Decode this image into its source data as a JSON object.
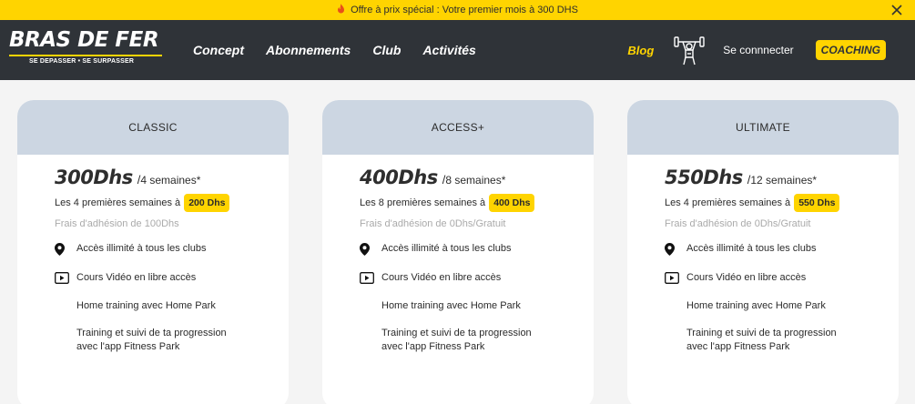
{
  "promo": {
    "text": "Offre à prix spécial : Votre premier mois à 300 DHS",
    "fire_icon": "fire-icon",
    "close_icon": "close-icon"
  },
  "brand": {
    "name": "BRAS DE FER",
    "tagline": "SE DEPASSER • SE SURPASSER"
  },
  "nav": {
    "links": [
      "Concept",
      "Abonnements",
      "Club",
      "Activités"
    ],
    "blog": "Blog",
    "lifter_icon": "weightlifter-icon",
    "connect": "Se connnecter",
    "coaching": "COACHING"
  },
  "colors": {
    "accent": "#ffd400",
    "nav_bg": "#2f3338",
    "card_head": "#ccd6e2",
    "muted": "#aaaaaa"
  },
  "plans": [
    {
      "name": "CLASSIC",
      "price": "300Dhs",
      "slash": "/",
      "period": "4 semaines*",
      "promo_text": "Les 4 premières semaines à",
      "promo_badge": "200 Dhs",
      "fee": "Frais d'adhésion de 100Dhs",
      "features": [
        "Accès illimité à tous les clubs",
        "Cours Vidéo en libre accès",
        "Home training avec Home Park",
        "Training et suivi de ta progression",
        "avec l'app Fitness Park"
      ]
    },
    {
      "name": "ACCESS+",
      "price": "400Dhs",
      "slash": "/",
      "period": "8 semaines*",
      "promo_text": "Les 8 premières semaines à",
      "promo_badge": "400 Dhs",
      "fee": "Frais d'adhésion de 0Dhs/Gratuit",
      "features": [
        "Accès illimité à tous les clubs",
        "Cours Vidéo en libre accès",
        "Home training avec Home Park",
        "Training et suivi de ta progression",
        "avec l'app Fitness Park"
      ]
    },
    {
      "name": "ULTIMATE",
      "price": "550Dhs",
      "slash": "/",
      "period": "12 semaines*",
      "promo_text": "Les 4 premières semaines à",
      "promo_badge": "550 Dhs",
      "fee": "Frais d'adhésion de 0Dhs/Gratuit",
      "features": [
        "Accès illimité à tous les clubs",
        "Cours Vidéo en libre accès",
        "Home training avec Home Park",
        "Training et suivi de ta progression",
        "avec l'app Fitness Park"
      ]
    }
  ]
}
